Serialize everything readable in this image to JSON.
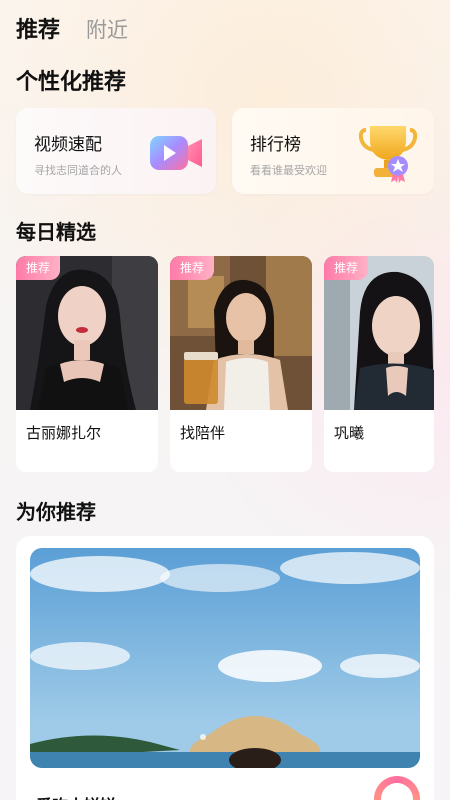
{
  "tabs": {
    "active": "推荐",
    "inactive": "附近"
  },
  "sections": {
    "personalized": "个性化推荐",
    "daily": "每日精选",
    "for_you": "为你推荐"
  },
  "features": [
    {
      "title": "视频速配",
      "subtitle": "寻找志同道合的人",
      "icon": "video-icon"
    },
    {
      "title": "排行榜",
      "subtitle": "看看谁最受欢迎",
      "icon": "trophy-icon"
    }
  ],
  "daily_picks": [
    {
      "badge": "推荐",
      "name": "古丽娜扎尔"
    },
    {
      "badge": "推荐",
      "name": "找陪伴"
    },
    {
      "badge": "推荐",
      "name": "巩曦"
    }
  ],
  "recommend": {
    "name": "爱吃小饼饼"
  },
  "colors": {
    "accent_pink": "#ff7aa7",
    "text_primary": "#111111",
    "text_muted": "#a5a5a5"
  }
}
